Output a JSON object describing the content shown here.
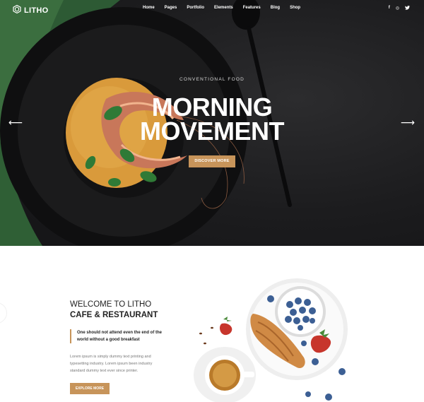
{
  "brand": {
    "name": "LITHO"
  },
  "nav": {
    "items": [
      {
        "label": "Home"
      },
      {
        "label": "Pages"
      },
      {
        "label": "Portfolio"
      },
      {
        "label": "Elements"
      },
      {
        "label": "Features"
      },
      {
        "label": "Blog"
      },
      {
        "label": "Shop"
      }
    ],
    "social": [
      {
        "icon": "facebook-icon",
        "glyph": "f"
      },
      {
        "icon": "instagram-icon",
        "glyph": "◎"
      },
      {
        "icon": "twitter-icon",
        "glyph": "🐦"
      }
    ]
  },
  "hero": {
    "eyebrow": "CONVENTIONAL FOOD",
    "headline_line1": "MORNING",
    "headline_line2": "MOVEMENT",
    "cta_label": "DISCOVER MORE",
    "prev_arrow": "⟵",
    "next_arrow": "⟶"
  },
  "welcome": {
    "title_line1": "WELCOME TO LITHO",
    "title_line2": "CAFE & RESTAURANT",
    "quote": "One should not attend even the end of the world without a good breakfast",
    "body": "Lorem ipsum is simply dummy text printing and typesetting industry. Lorem ipsum been industry standard dummy text ever since printer.",
    "cta_label": "EXPLORE MORE"
  },
  "colors": {
    "accent": "#c7945a",
    "hero_bg": "#1c1c1e",
    "text_dark": "#222222"
  }
}
